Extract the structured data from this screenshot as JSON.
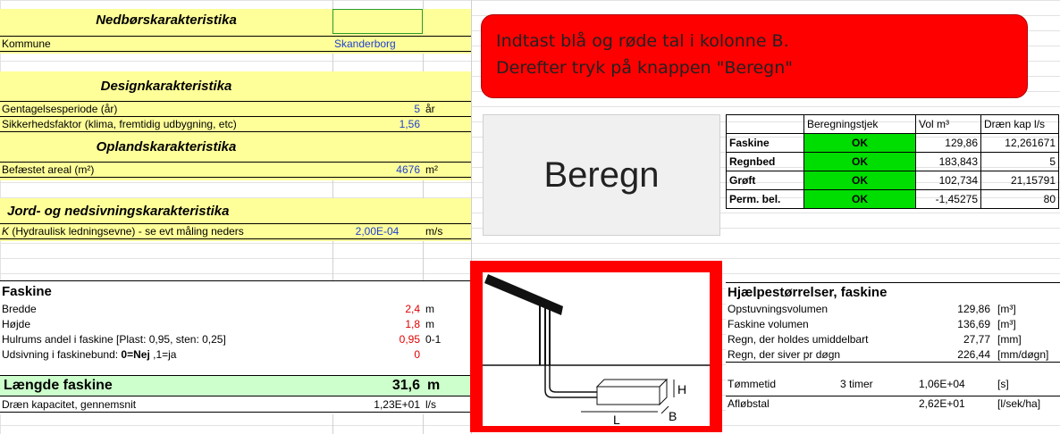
{
  "nedbor": {
    "header": "Nedbørskarakteristika",
    "kommune_label": "Kommune",
    "kommune_value": "Skanderborg"
  },
  "design": {
    "header": "Designkarakteristika",
    "gentagelse_label": "Gentagelsesperiode (år)",
    "gentagelse_value": "5",
    "gentagelse_unit": "år",
    "sikkerhed_label": "Sikkerhedsfaktor (klima, fremtidig udbygning, etc)",
    "sikkerhed_value": "1,56"
  },
  "opland": {
    "header": "Oplandskarakteristika",
    "areal_label": "Befæstet areal (m²)",
    "areal_value": "4676",
    "areal_unit": "m²"
  },
  "jord": {
    "header": "Jord- og nedsivningskarakteristika",
    "k_symbol": "K",
    "k_label": " (Hydraulisk  ledningsevne) - se evt måling neders",
    "k_value": "2,00E-04",
    "k_unit": "m/s"
  },
  "faskine": {
    "header": "Faskine",
    "rows": [
      {
        "label": "Bredde",
        "value": "2,4",
        "unit": "m"
      },
      {
        "label": "Højde",
        "value": "1,8",
        "unit": "m"
      },
      {
        "label": "Hulrums andel i faskine [Plast: 0,95, sten: 0,25]",
        "value": "0,95",
        "unit": "0-1"
      },
      {
        "label_pre": "Udsivning i faskinebund: ",
        "label_b1": "0=Nej",
        "label_mid": " ,1=ja",
        "value": "0",
        "unit": ""
      }
    ],
    "laengde_label": "Længde faskine",
    "laengde_value": "31,6",
    "laengde_unit": "m",
    "draen_label": "Dræn kapacitet, gennemsnit",
    "draen_value": "1,23E+01",
    "draen_unit": "l/s"
  },
  "notice": {
    "line1": "Indtast blå og røde tal i kolonne B.",
    "line2": "Derefter tryk på knappen \"Beregn\""
  },
  "beregn_button": "Beregn",
  "results": {
    "headers": [
      "Beregningstjek",
      "Vol m³",
      "Dræn kap l/s"
    ],
    "rows": [
      {
        "name": "Faskine",
        "status": "OK",
        "vol": "129,86",
        "draen": "12,261671"
      },
      {
        "name": "Regnbed",
        "status": "OK",
        "vol": "183,843",
        "draen": "5"
      },
      {
        "name": "Grøft",
        "status": "OK",
        "vol": "102,734",
        "draen": "21,15791"
      },
      {
        "name": "Perm. bel.",
        "status": "OK",
        "vol": "-1,45275",
        "draen": "80"
      }
    ]
  },
  "diagram": {
    "label_L": "L",
    "label_B": "B",
    "label_H": "H"
  },
  "hjaelp": {
    "header": "Hjælpestørrelser, faskine",
    "rows": [
      {
        "label": "Opstuvningsvolumen",
        "mid": "",
        "value": "129,86",
        "unit": "[m³]"
      },
      {
        "label": "Faskine volumen",
        "mid": "",
        "value": "136,69",
        "unit": "[m³]"
      },
      {
        "label": "Regn, der holdes umiddelbart",
        "mid": "",
        "value": "27,77",
        "unit": "[mm]"
      },
      {
        "label": "Regn, der siver pr døgn",
        "mid": "",
        "value": "226,44",
        "unit": "[mm/døgn]"
      },
      {
        "label": "Tømmetid",
        "mid": "3 timer",
        "value": "1,06E+04",
        "unit": "[s]"
      },
      {
        "label": "Afløbstal",
        "mid": "",
        "value": "2,62E+01",
        "unit": "[l/sek/ha]"
      }
    ]
  },
  "colors": {
    "yellow": "#ffff99",
    "green_cell": "#ccffcc",
    "red_box": "#ff0000",
    "ok_green": "#00dd00",
    "blue_text": "#1f3fd0",
    "red_text": "#e00000"
  }
}
